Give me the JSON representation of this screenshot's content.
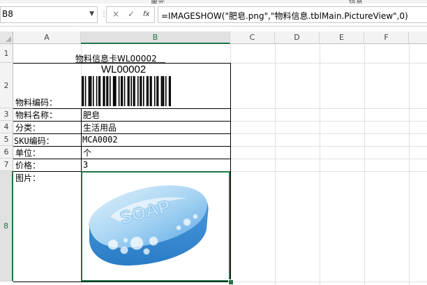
{
  "ribbon": {
    "group1": "单元",
    "group2": "信息"
  },
  "formula_bar": {
    "name_box": "B8",
    "cancel_glyph": "×",
    "enter_glyph": "✓",
    "fx_glyph": "fx",
    "formula": "=IMAGESHOW(\"肥皂.png\",\"物料信息.tblMain.PictureView\",0)"
  },
  "columns": [
    "A",
    "B",
    "C",
    "D",
    "E",
    "F"
  ],
  "rows": [
    "1",
    "2",
    "3",
    "4",
    "5",
    "6",
    "7",
    "8"
  ],
  "selected": {
    "column": "B",
    "row": "8"
  },
  "card": {
    "title": "物料信息卡WL00002",
    "barcode_text": "WL00002",
    "barcode_pattern": "11010011101001011001101101001110010110100110101100101101001101100101100111010011",
    "fields": [
      {
        "label": "物料编码：",
        "value": ""
      },
      {
        "label": "物料名称：",
        "value": "肥皂"
      },
      {
        "label": "分类：",
        "value": "生活用品"
      },
      {
        "label": "SKU编码：",
        "value": "MCA0002"
      },
      {
        "label": "单位：",
        "value": "个"
      },
      {
        "label": "价格：",
        "value": "3"
      },
      {
        "label": "图片：",
        "value": ""
      }
    ],
    "image_text": "SOAP",
    "colors": {
      "soap_light": "#bfe0f7",
      "soap_mid": "#6fb6ea",
      "soap_dark": "#2f86cf"
    }
  },
  "accent": "#217346"
}
